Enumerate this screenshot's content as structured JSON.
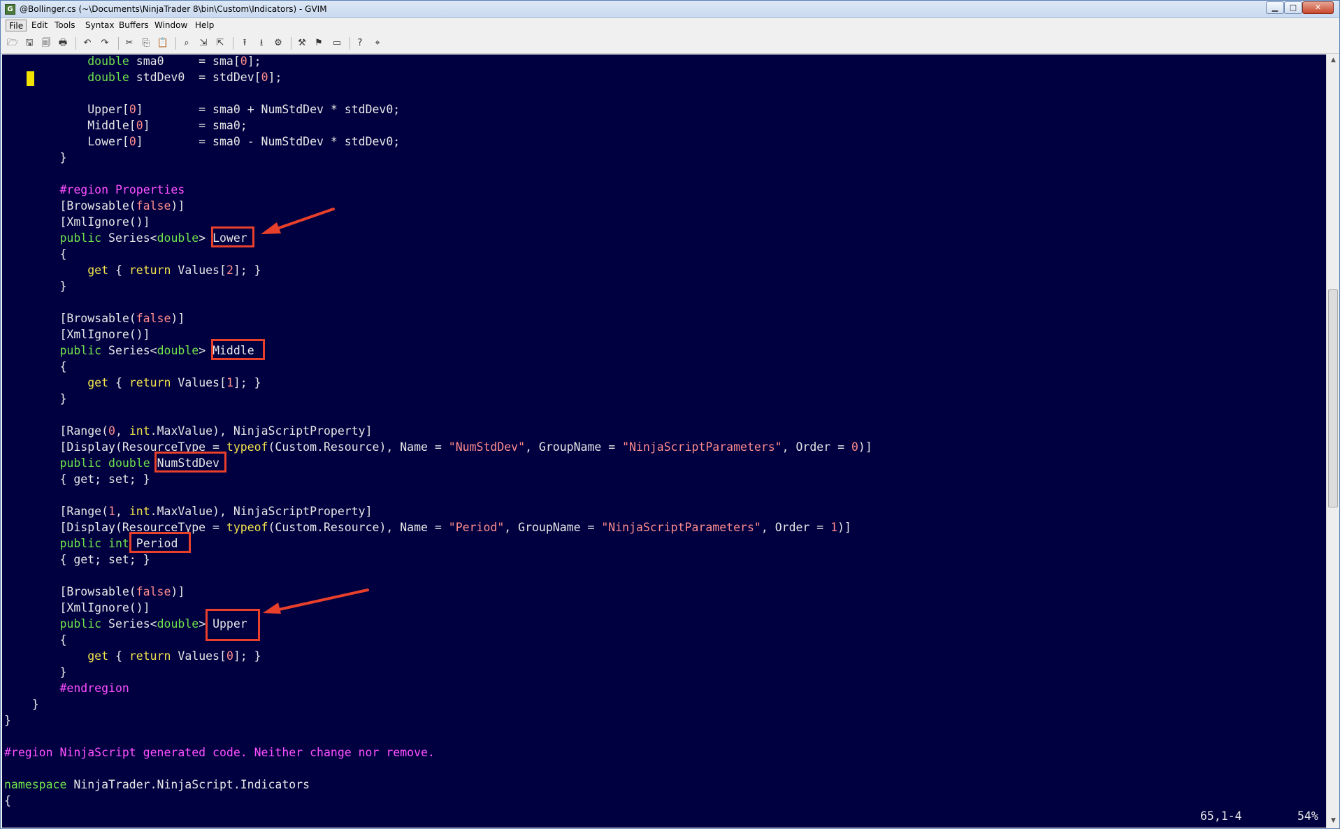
{
  "window": {
    "title": "@Bollinger.cs (~\\Documents\\NinjaTrader 8\\bin\\Custom\\Indicators) - GVIM",
    "app_icon": "G",
    "minimize_glyph": "▁",
    "maximize_glyph": "□",
    "close_glyph": "✕"
  },
  "menu": {
    "file": "File",
    "edit": "Edit",
    "tools": "Tools",
    "syntax": "Syntax",
    "buffers": "Buffers",
    "window": "Window",
    "help": "Help"
  },
  "toolbar": {
    "open": "🗁",
    "save": "🖫",
    "save_all": "🗐",
    "print": "🖶",
    "undo": "↶",
    "redo": "↷",
    "cut": "✂",
    "copy": "⎘",
    "paste": "📋",
    "find_replace": "⌕",
    "find_next": "⇲",
    "find_prev": "⇱",
    "load_session": "⭱",
    "save_session": "⭳",
    "run_script": "⚙",
    "make": "⚒",
    "build_tags": "⚑",
    "jump_tag": "▭",
    "help": "?",
    "find_help": "⌖"
  },
  "code": {
    "l1": {
      "a": "            ",
      "kw": "double",
      "b": " sma0     = sma[",
      "n": "0",
      "c": "];"
    },
    "l2": {
      "a": "            ",
      "kw": "double",
      "b": " stdDev0  = stdDev[",
      "n": "0",
      "c": "];"
    },
    "l4": {
      "a": "            Upper[",
      "n": "0",
      "b": "]        = sma0 + NumStdDev * stdDev0;"
    },
    "l5": {
      "a": "            Middle[",
      "n": "0",
      "b": "]       = sma0;"
    },
    "l6": {
      "a": "            Lower[",
      "n": "0",
      "b": "]        = sma0 - NumStdDev * stdDev0;"
    },
    "l7": "        }",
    "l9": {
      "a": "        ",
      "region": "#region Properties"
    },
    "l10": {
      "a": "        [Browsable(",
      "kw": "false",
      "b": ")]"
    },
    "l11": "        [XmlIgnore()]",
    "l12": {
      "a": "        ",
      "kw1": "public",
      "b": " Series<",
      "kw2": "double",
      "c": "> ",
      "name": "Lower"
    },
    "l13": "        {",
    "l14": {
      "a": "            ",
      "kw1": "get",
      "b": " { ",
      "kw2": "return",
      "c": " Values[",
      "n": "2",
      "d": "]; }"
    },
    "l15": "        }",
    "l17": {
      "a": "        [Browsable(",
      "kw": "false",
      "b": ")]"
    },
    "l18": "        [XmlIgnore()]",
    "l19": {
      "a": "        ",
      "kw1": "public",
      "b": " Series<",
      "kw2": "double",
      "c": "> ",
      "name": "Middle"
    },
    "l20": "        {",
    "l21": {
      "a": "            ",
      "kw1": "get",
      "b": " { ",
      "kw2": "return",
      "c": " Values[",
      "n": "1",
      "d": "]; }"
    },
    "l22": "        }",
    "l24": {
      "a": "        [Range(",
      "n1": "0",
      "b": ", ",
      "kw": "int",
      "c": ".MaxValue), NinjaScriptProperty]"
    },
    "l25": {
      "a": "        [Display(ResourceType = ",
      "kw": "typeof",
      "b": "(Custom.Resource), Name = ",
      "s1": "\"NumStdDev\"",
      "c": ", GroupName = ",
      "s2": "\"NinjaScriptParameters\"",
      "d": ", Order = ",
      "n": "0",
      "e": ")]"
    },
    "l26": {
      "a": "        ",
      "kw1": "public",
      "b": " ",
      "kw2": "double",
      "c": " ",
      "name": "NumStdDev"
    },
    "l27": "        { get; set; }",
    "l29": {
      "a": "        [Range(",
      "n1": "1",
      "b": ", ",
      "kw": "int",
      "c": ".MaxValue), NinjaScriptProperty]"
    },
    "l30": {
      "a": "        [Display(ResourceType = ",
      "kw": "typeof",
      "b": "(Custom.Resource), Name = ",
      "s1": "\"Period\"",
      "c": ", GroupName = ",
      "s2": "\"NinjaScriptParameters\"",
      "d": ", Order = ",
      "n": "1",
      "e": ")]"
    },
    "l31": {
      "a": "        ",
      "kw1": "public",
      "b": " ",
      "kw2": "int",
      "c": " ",
      "name": "Period"
    },
    "l32": "        { get; set; }",
    "l34": {
      "a": "        [Browsable(",
      "kw": "false",
      "b": ")]"
    },
    "l35": "        [XmlIgnore()]",
    "l36": {
      "a": "        ",
      "kw1": "public",
      "b": " Series<",
      "kw2": "double",
      "c": "> ",
      "name": "Upper"
    },
    "l37": "        {",
    "l38": {
      "a": "            ",
      "kw1": "get",
      "b": " { ",
      "kw2": "return",
      "c": " Values[",
      "n": "0",
      "d": "]; }"
    },
    "l39": "        }",
    "l40": {
      "a": "        ",
      "region": "#endregion"
    },
    "l41": "    }",
    "l42": "}",
    "l44": "#region NinjaScript generated code. Neither change nor remove.",
    "l46": {
      "kw": "namespace",
      "b": " NinjaTrader.NinjaScript.Indicators"
    },
    "l47": "{"
  },
  "status": {
    "position": "65,1-4",
    "percent": "54%"
  },
  "colors": {
    "background": "#000040",
    "keyword_green": "#6fe34b",
    "keyword_yellow": "#f2e24b",
    "preproc_magenta": "#ff50ff",
    "literal_pink": "#ff8c8c",
    "annotation_red": "#e8402a",
    "cursor_yellow": "#f2e200"
  }
}
